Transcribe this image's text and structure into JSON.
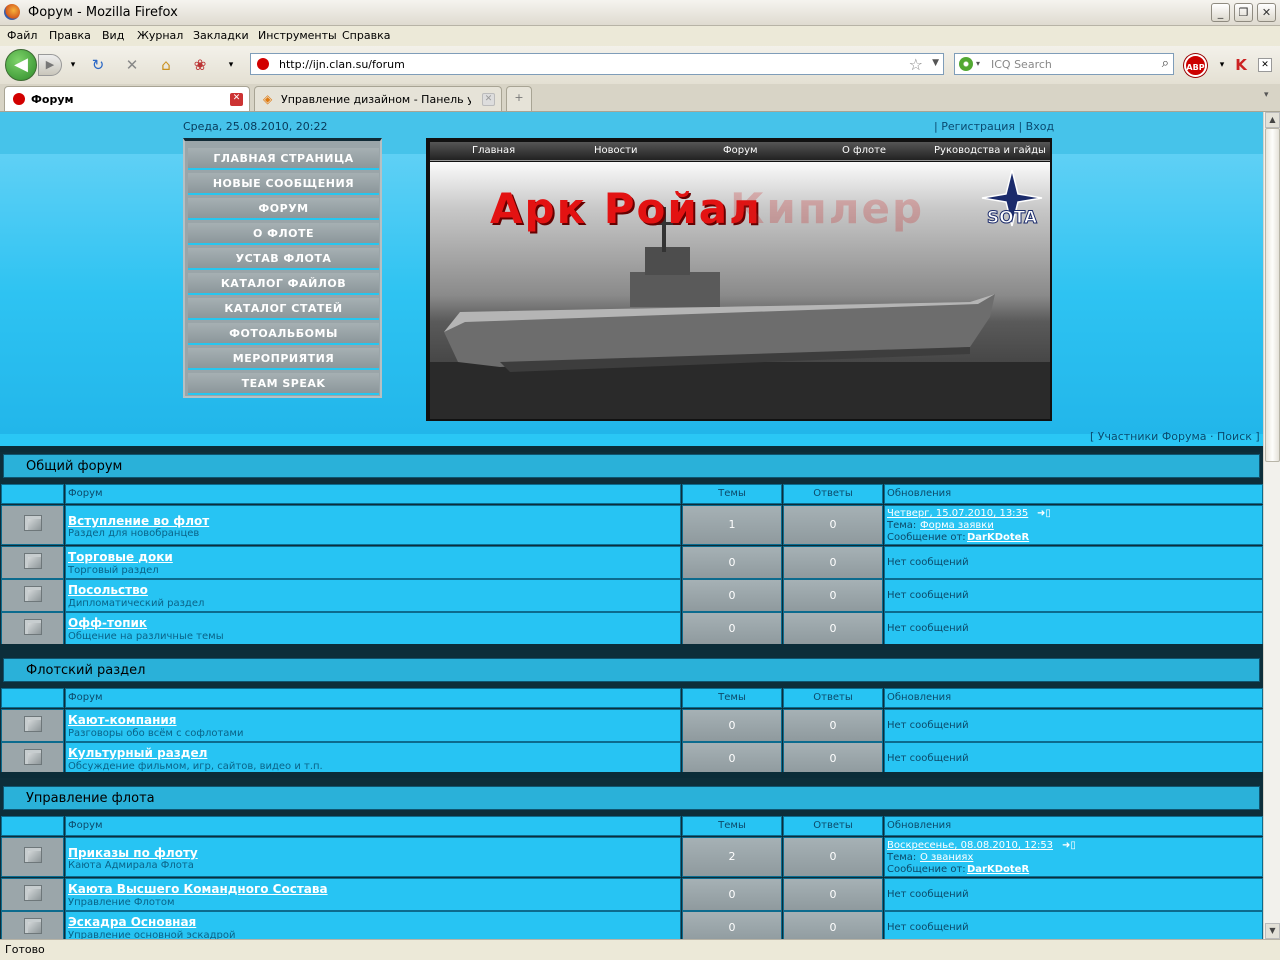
{
  "window": {
    "title": "Форум - Mozilla Firefox"
  },
  "menu": [
    "Файл",
    "Правка",
    "Вид",
    "Журнал",
    "Закладки",
    "Инструменты",
    "Справка"
  ],
  "nav": {
    "url": "http://ijn.clan.su/forum",
    "search_placeholder": "ICQ Search"
  },
  "tabs": [
    {
      "label": "Форум",
      "active": true
    },
    {
      "label": "Управление дизайном - Панель упра...",
      "active": false
    }
  ],
  "status": "Готово",
  "site": {
    "date": "Среда, 25.08.2010, 20:22",
    "top_links": "| Регистрация | Вход",
    "menu": [
      "ГЛАВНАЯ СТРАНИЦА",
      "НОВЫЕ СООБЩЕНИЯ",
      "ФОРУМ",
      "О ФЛОТЕ",
      "УСТАВ ФЛОТА",
      "КАТАЛОГ ФАЙЛОВ",
      "КАТАЛОГ СТАТЕЙ",
      "ФОТОАЛЬБОМЫ",
      "МЕРОПРИЯТИЯ",
      "TEAM SPEAK"
    ],
    "banner_nav": [
      "Главная",
      "Новости",
      "Форум",
      "О флоте",
      "Руководства и гайды"
    ],
    "banner_title": "Арк Ройал",
    "banner_title_faded": "Киплер",
    "banner_logo": "SOTA",
    "forum_links": "[ Участники Форума · Поиск ]"
  },
  "columns": {
    "forum": "Форум",
    "topics": "Темы",
    "replies": "Ответы",
    "updates": "Обновления"
  },
  "categories": [
    {
      "title": "Общий форум",
      "forums": [
        {
          "name": "Вступление во флот",
          "desc": "Раздел для новобранцев",
          "topics": "1",
          "replies": "0",
          "last": {
            "date": "Четверг, 15.07.2010, 13:35",
            "topic_label": "Тема:",
            "topic": "Форма заявки",
            "by_label": "Сообщение от:",
            "by": "DarKDoteR"
          }
        },
        {
          "name": "Торговые доки",
          "desc": "Торговый раздел",
          "topics": "0",
          "replies": "0",
          "none": "Нет сообщений"
        },
        {
          "name": "Посольство",
          "desc": "Дипломатический раздел",
          "topics": "0",
          "replies": "0",
          "none": "Нет сообщений"
        },
        {
          "name": "Офф-топик",
          "desc": "Общение на различные темы",
          "topics": "0",
          "replies": "0",
          "none": "Нет сообщений"
        }
      ]
    },
    {
      "title": "Флотский раздел",
      "forums": [
        {
          "name": "Кают-компания",
          "desc": "Разговоры обо всём с софлотами",
          "topics": "0",
          "replies": "0",
          "none": "Нет сообщений"
        },
        {
          "name": "Культурный раздел",
          "desc": "Обсуждение фильмом, игр, сайтов, видео и т.п.",
          "topics": "0",
          "replies": "0",
          "none": "Нет сообщений"
        }
      ]
    },
    {
      "title": "Управление флота",
      "forums": [
        {
          "name": "Приказы по флоту",
          "desc": "Каюта Адмирала Флота",
          "topics": "2",
          "replies": "0",
          "last": {
            "date": "Воскресенье, 08.08.2010, 12:53",
            "topic_label": "Тема:",
            "topic": "О званиях",
            "by_label": "Сообщение от:",
            "by": "DarKDoteR"
          }
        },
        {
          "name": "Каюта Высшего Командного Состава",
          "desc": "Управление Флотом",
          "topics": "0",
          "replies": "0",
          "none": "Нет сообщений"
        },
        {
          "name": "Эскадра Основная",
          "desc": "Управление основной эскадрой",
          "topics": "0",
          "replies": "0",
          "none": "Нет сообщений"
        }
      ]
    }
  ]
}
